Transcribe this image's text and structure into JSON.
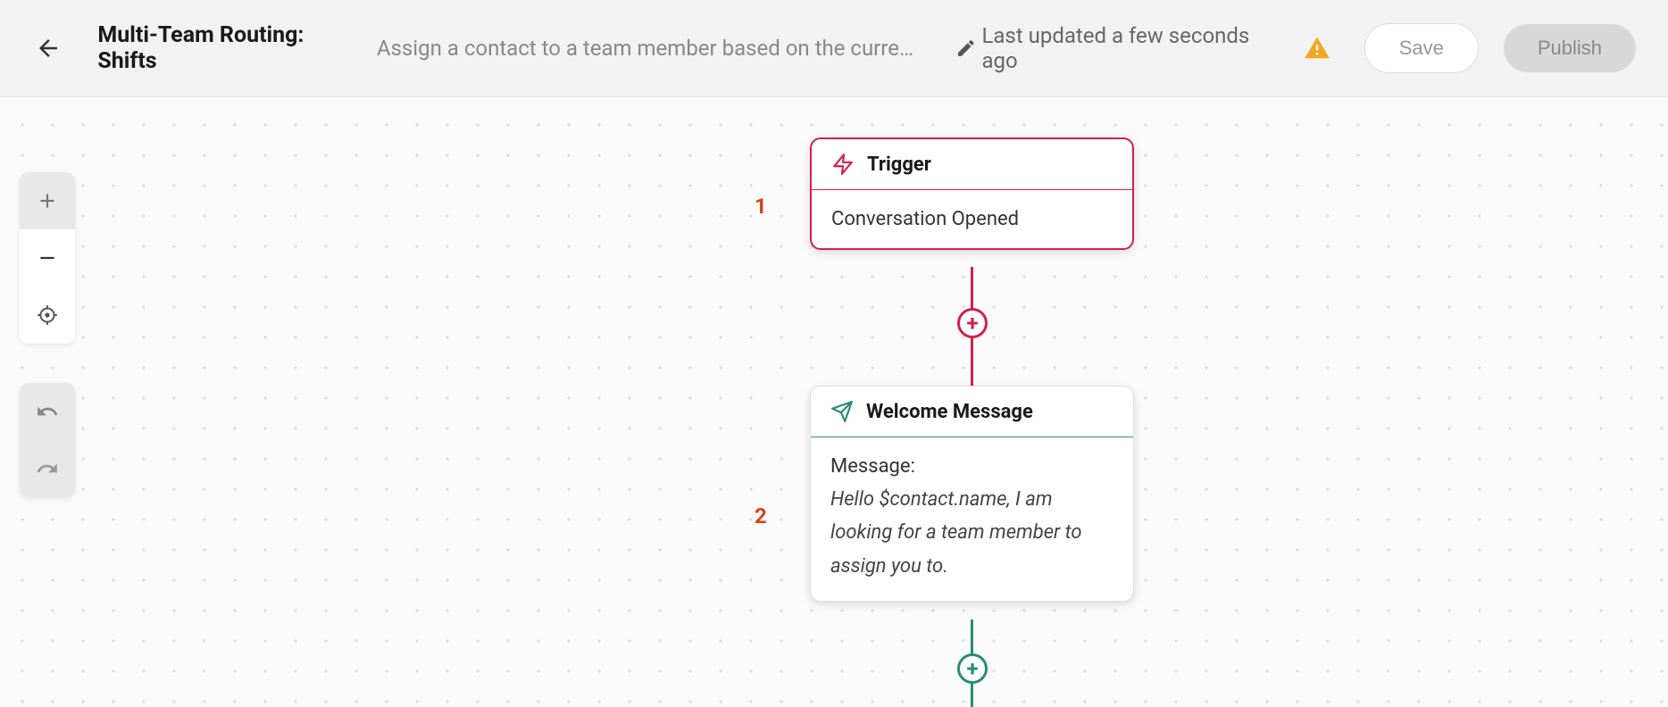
{
  "header": {
    "title": "Multi-Team Routing: Shifts",
    "subtitle": "Assign a contact to a team member based on the current …",
    "last_updated": "Last updated a few seconds ago",
    "save_label": "Save",
    "publish_label": "Publish"
  },
  "nodes": {
    "trigger": {
      "number": "1",
      "title": "Trigger",
      "body": "Conversation Opened",
      "accent_color": "#d1214a"
    },
    "welcome": {
      "number": "2",
      "title": "Welcome Message",
      "message_label": "Message:",
      "message_body": "Hello $contact.name, I am looking for a team member to assign you to.",
      "accent_color": "#2b8a7a"
    }
  }
}
